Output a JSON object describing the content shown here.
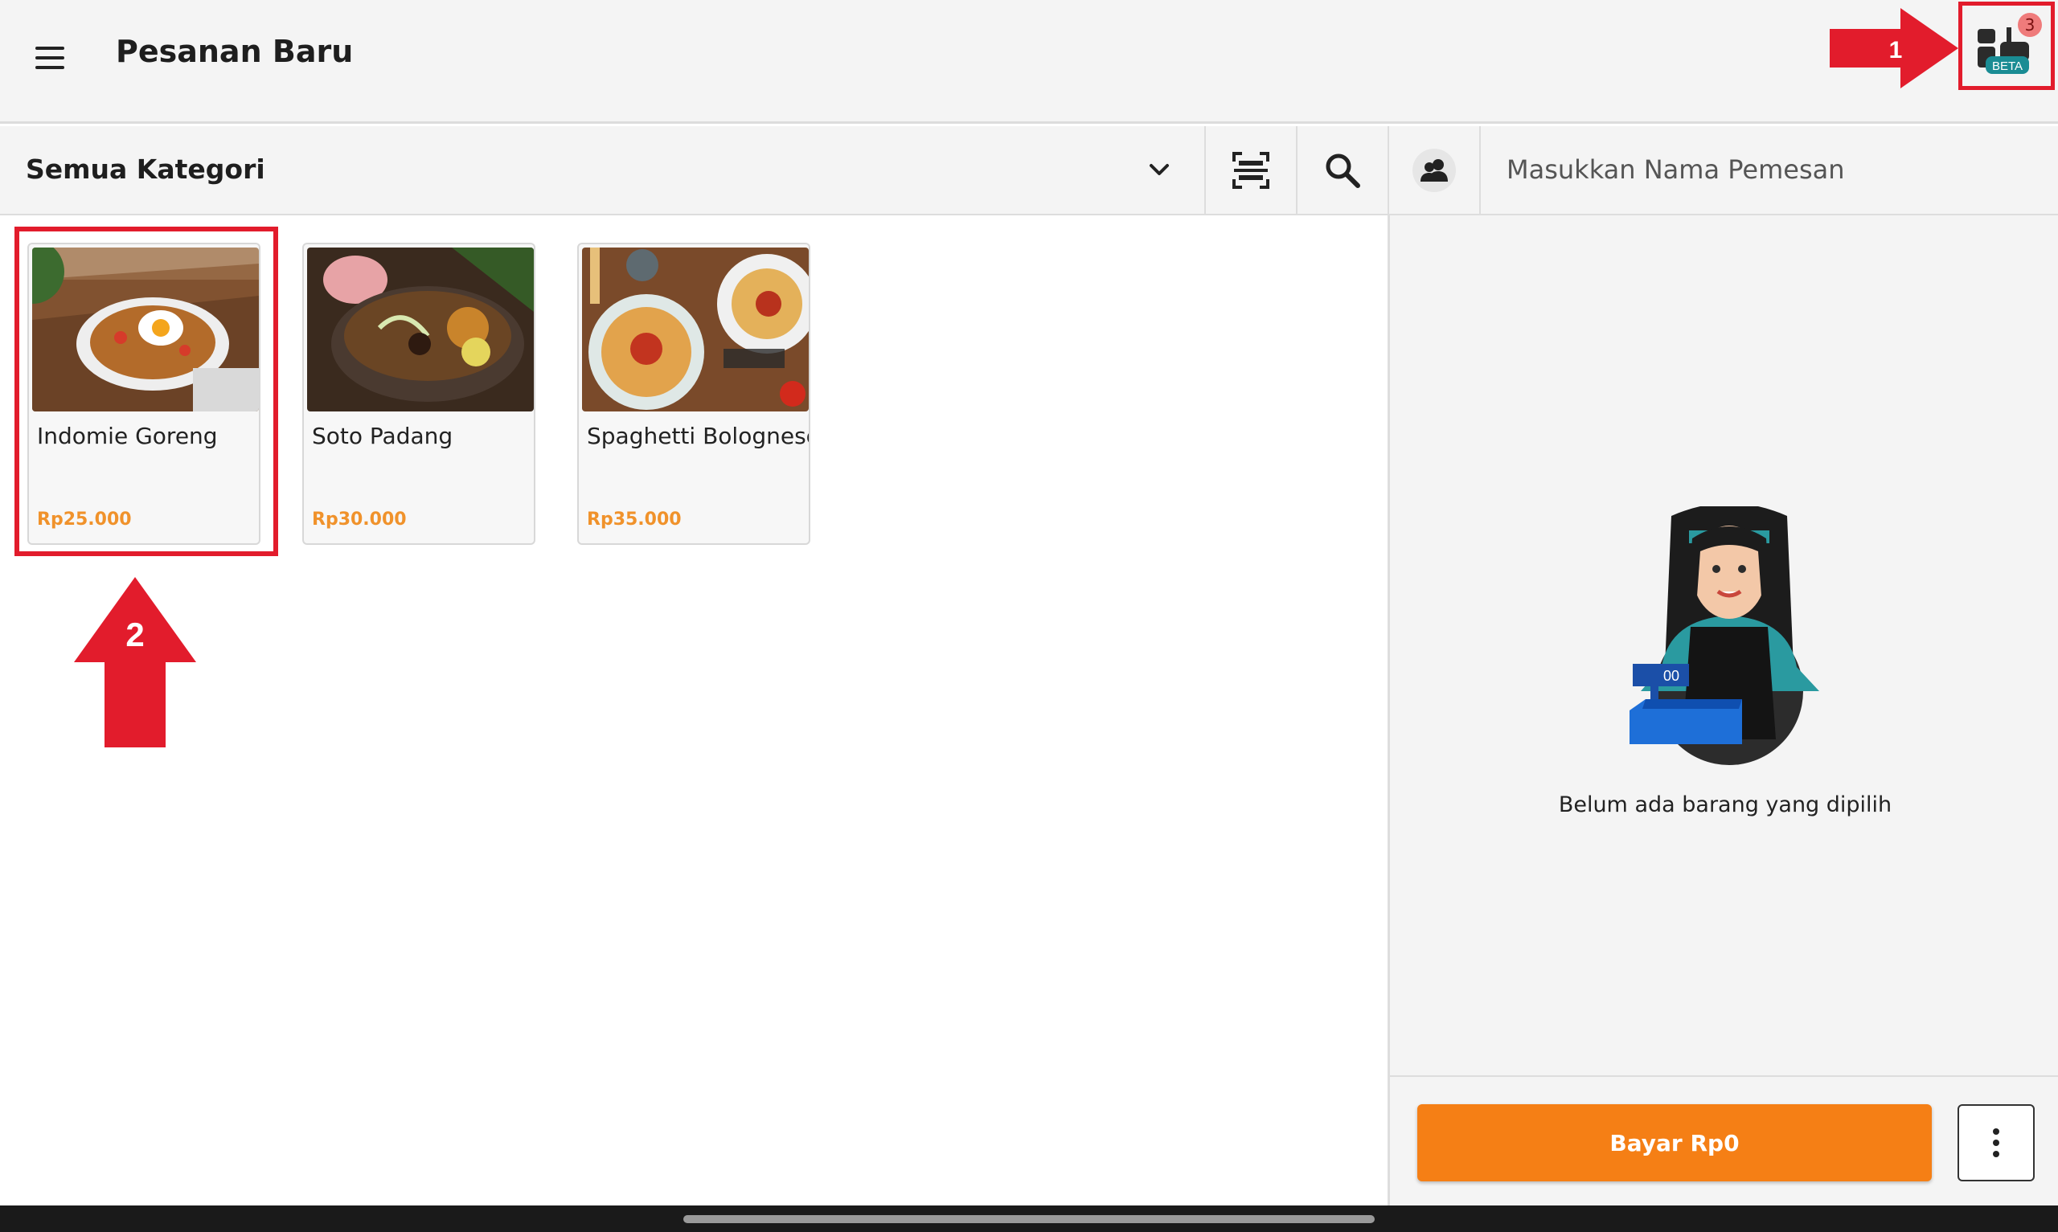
{
  "header": {
    "title": "Pesanan Baru",
    "menu_icon": "hamburger-menu-icon",
    "beta_feature": {
      "icon": "pending-orders-icon",
      "badge_label": "BETA",
      "notification_count": "3"
    }
  },
  "toolbar": {
    "category_label": "Semua Kategori",
    "scan_icon": "barcode-scan-icon",
    "search_icon": "search-icon",
    "customer_icon": "customer-icon",
    "customer_placeholder": "Masukkan Nama Pemesan"
  },
  "products": [
    {
      "name": "Indomie Goreng",
      "price": "Rp25.000"
    },
    {
      "name": "Soto Padang",
      "price": "Rp30.000"
    },
    {
      "name": "Spaghetti Bolognese",
      "price": "Rp35.000"
    }
  ],
  "cart": {
    "empty_message": "Belum ada barang yang dipilih",
    "register_display": "00",
    "pay_label": "Bayar Rp0",
    "more_icon": "more-vertical-icon"
  },
  "annotations": {
    "step_1": "1",
    "step_2": "2",
    "color": "#e21c2c"
  },
  "colors": {
    "accent": "#f57f15",
    "price": "#f0922b",
    "beta_teal": "#1a8c94"
  }
}
